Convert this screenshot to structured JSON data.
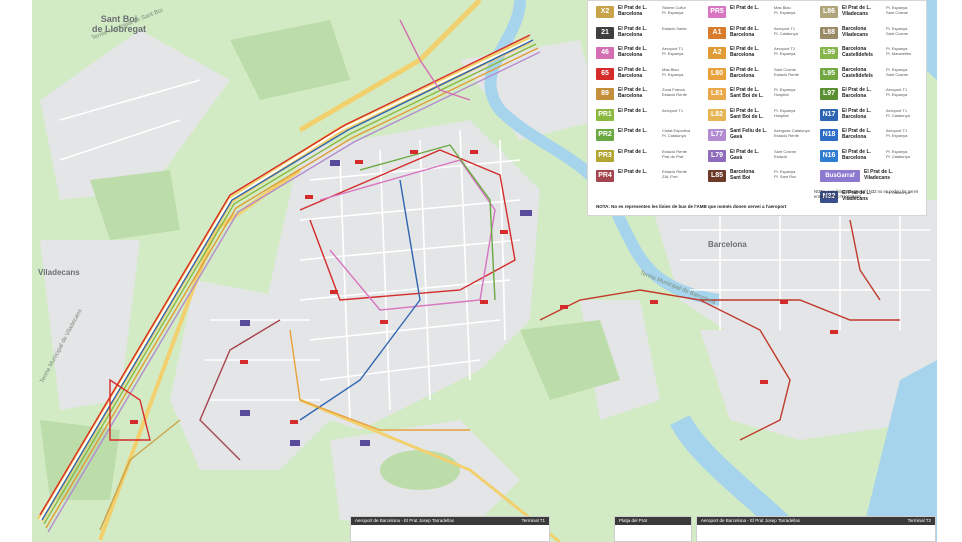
{
  "places": {
    "sant_boi": "Sant Boi\nde Llobregat",
    "viladecans": "Viladecans",
    "barcelona": "Barcelona"
  },
  "roads": {
    "terme_sant_boi": "Terme Municipal de Sant Boi",
    "terme_viladecans": "Terme Municipal de Viladecans",
    "terme_barcelona": "Terme Municipal de Barcelona"
  },
  "legend": {
    "lines": [
      {
        "code": "X2",
        "color": "#c8a34a",
        "name": "El Prat de L.\nBarcelona",
        "stop": "Sistem Cultur\nPl. Espanya"
      },
      {
        "code": "21",
        "color": "#3f3f3f",
        "name": "El Prat de L.\nBarcelona",
        "stop": "Estació Sants"
      },
      {
        "code": "46",
        "color": "#d46fb3",
        "name": "El Prat de L.\nBarcelona",
        "stop": "Aeroport T1\nPl. Espanya"
      },
      {
        "code": "65",
        "color": "#d52b2b",
        "name": "El Prat de L.\nBarcelona",
        "stop": "Mas Blau\nPl. Espanya"
      },
      {
        "code": "89",
        "color": "#c58e3a",
        "name": "El Prat de L.\nBarcelona",
        "stop": "Zona Franca\nEstació Renfe"
      },
      {
        "code": "PR1",
        "color": "#8bb83f",
        "name": "El Prat de L.",
        "stop": "Aeroport T1"
      },
      {
        "code": "PR2",
        "color": "#6aa842",
        "name": "El Prat de L.",
        "stop": "Ciutat Esportiva\nPl. Catalunya"
      },
      {
        "code": "PR3",
        "color": "#b3a534",
        "name": "El Prat de L.",
        "stop": "Estació Renfe\nPrat de Prat"
      },
      {
        "code": "PR4",
        "color": "#a5454f",
        "name": "El Prat de L.",
        "stop": "Estació Renfe\nZAL Port"
      },
      {
        "code": "PR5",
        "color": "#d874c0",
        "name": "El Prat de L.",
        "stop": "Mas Blau\nPl. Espanya"
      },
      {
        "code": "A1",
        "color": "#d97b2c",
        "name": "El Prat de L.\nBarcelona",
        "stop": "Aeroport T1\nPl. Catalunya"
      },
      {
        "code": "A2",
        "color": "#e09b36",
        "name": "El Prat de L.\nBarcelona",
        "stop": "Aeroport T2\nPl. Espanya"
      },
      {
        "code": "L80",
        "color": "#e8a13b",
        "name": "El Prat de L.\nBarcelona",
        "stop": "Sant Cosme\nEstació Renfe"
      },
      {
        "code": "L81",
        "color": "#e9a94a",
        "name": "El Prat de L.\nSant Boi de L.",
        "stop": "Pl. Espanya\nHospital"
      },
      {
        "code": "L82",
        "color": "#e8b554",
        "name": "El Prat de L.\nSant Boi de L.",
        "stop": "Pl. Espanya\nHospital"
      },
      {
        "code": "L77",
        "color": "#b28bd1",
        "name": "Sant Feliu de L.\nGavà",
        "stop": "Avinguda Catalunya\nEstació Renfe"
      },
      {
        "code": "L79",
        "color": "#8e6bbb",
        "name": "El Prat de L.\nGavà",
        "stop": "Sant Cosme\nEstació"
      },
      {
        "code": "L85",
        "color": "#6d3a2a",
        "name": "Barcelona\nSant Boi",
        "stop": "Pl. Espanya\nPl. Sant Roc"
      },
      {
        "code": "L86",
        "color": "#b0a57a",
        "name": "El Prat de L.\nViladecans",
        "stop": "Pl. Espanya\nSant Cosme"
      },
      {
        "code": "L88",
        "color": "#9a8a65",
        "name": "Barcelona\nViladecans",
        "stop": "Pl. Espanya\nSant Cosme"
      },
      {
        "code": "L99",
        "color": "#86b54b",
        "name": "Barcelona\nCastelldefels",
        "stop": "Pl. Espanya\nPl. Maravelles"
      },
      {
        "code": "L95",
        "color": "#70a741",
        "name": "Barcelona\nCastelldefels",
        "stop": "Pl. Espanya\nSant Cosme"
      },
      {
        "code": "L97",
        "color": "#5a8f32",
        "name": "El Prat de L.\nBarcelona",
        "stop": "Aeroport T1\nPl. Espanya"
      },
      {
        "code": "N17",
        "color": "#2f66b3",
        "name": "El Prat de L.\nBarcelona",
        "stop": "Aeroport T1\nPl. Catalunya"
      },
      {
        "code": "N18",
        "color": "#2f6ec7",
        "name": "El Prat de L.\nBarcelona",
        "stop": "Aeroport T1\nPl. Espanya"
      },
      {
        "code": "N16",
        "color": "#2f7cd1",
        "name": "El Prat de L.\nBarcelona",
        "stop": "Pl. Espanya\nPl. Catalunya"
      },
      {
        "code": "BusGarraf",
        "color": "#8c7ad0",
        "name": "El Prat de L.\nViladecans",
        "stop": "Pl. Espanya"
      },
      {
        "code": "N32",
        "color": "#3a4f8c",
        "name": "El Prat de L.\nViladecans",
        "stop": "Pl. Catalunya"
      }
    ],
    "note": "NOTA: No es representen les línies de bus de l'AMB que només donen servei a l'aeroport",
    "bus_note": "NOTA: Les línies BusGarraf i N32 no es poden fer servir entre El Prat i l'Hospitalet."
  },
  "insets": [
    {
      "title": "Aeroport de Barcelona - El Prat Josep Tarradellas",
      "terminal": "Terminal T1"
    },
    {
      "title": "Platja del Prat",
      "terminal": ""
    },
    {
      "title": "Aeroport de Barcelona - El Prat Josep Tarradellas",
      "terminal": "Terminal T2"
    }
  ],
  "colors": {
    "green_area": "#cfe8c0",
    "park": "#b9dca6",
    "water": "#9fd0ea",
    "urban": "#e6e7e8",
    "road": "#ffffff",
    "primary_road": "#f3d26e"
  }
}
